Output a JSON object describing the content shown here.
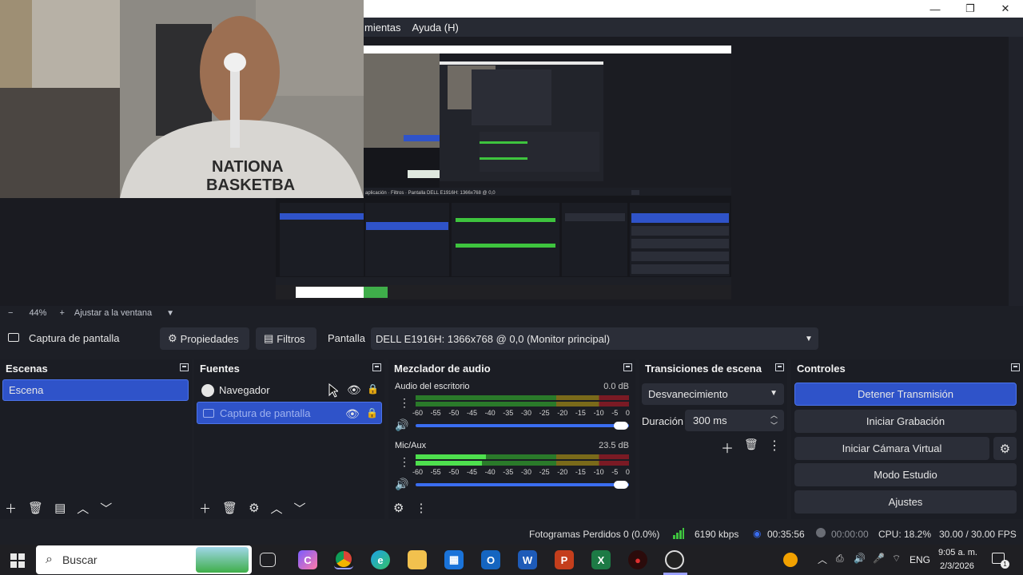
{
  "titlebar": {
    "minimize": "—",
    "maximize": "❐",
    "close": "✕"
  },
  "menu": {
    "items": [
      "mientas",
      "Ayuda (H)"
    ]
  },
  "zoom": {
    "minus": "−",
    "value": "44%",
    "plus": "+",
    "fit": "Ajustar a la ventana"
  },
  "source_toolbar": {
    "source_name": "Captura de pantalla",
    "properties": "Propiedades",
    "filters": "Filtros",
    "display_label": "Pantalla",
    "display_value": "DELL E1916H: 1366x768 @ 0,0 (Monitor principal)"
  },
  "scenes": {
    "title": "Escenas",
    "items": [
      "Escena"
    ]
  },
  "sources": {
    "title": "Fuentes",
    "items": [
      "Navegador",
      "Captura de pantalla"
    ]
  },
  "mixer": {
    "title": "Mezclador de audio",
    "ticks": [
      "-60",
      "-55",
      "-50",
      "-45",
      "-40",
      "-35",
      "-30",
      "-25",
      "-20",
      "-15",
      "-10",
      "-5",
      "0"
    ],
    "channels": [
      {
        "name": "Audio del escritorio",
        "db": "0.0 dB",
        "level": 0.0,
        "volume": 1.0
      },
      {
        "name": "Mic/Aux",
        "db": "23.5 dB",
        "level": 0.33,
        "volume": 1.0
      }
    ]
  },
  "transitions": {
    "title": "Transiciones de escena",
    "selected": "Desvanecimiento",
    "duration_label": "Duración",
    "duration_value": "300 ms"
  },
  "controls": {
    "title": "Controles",
    "stop_stream": "Detener Transmisión",
    "start_record": "Iniciar Grabación",
    "virtual_cam": "Iniciar Cámara Virtual",
    "studio_mode": "Modo Estudio",
    "settings": "Ajustes"
  },
  "status": {
    "dropped": "Fotogramas Perdidos 0 (0.0%)",
    "bitrate": "6190 kbps",
    "stream_time": "00:35:56",
    "record_time": "00:00:00",
    "cpu": "CPU: 18.2%",
    "fps": "30.00 / 30.00 FPS"
  },
  "taskbar": {
    "search_placeholder": "Buscar",
    "lang": "ENG",
    "time": "9:05 a. m.",
    "date": "2/3/2026",
    "notif": "1"
  },
  "colors": {
    "accent": "#2f53c9",
    "background": "#1d1f26",
    "dock": "#1b1d24"
  }
}
